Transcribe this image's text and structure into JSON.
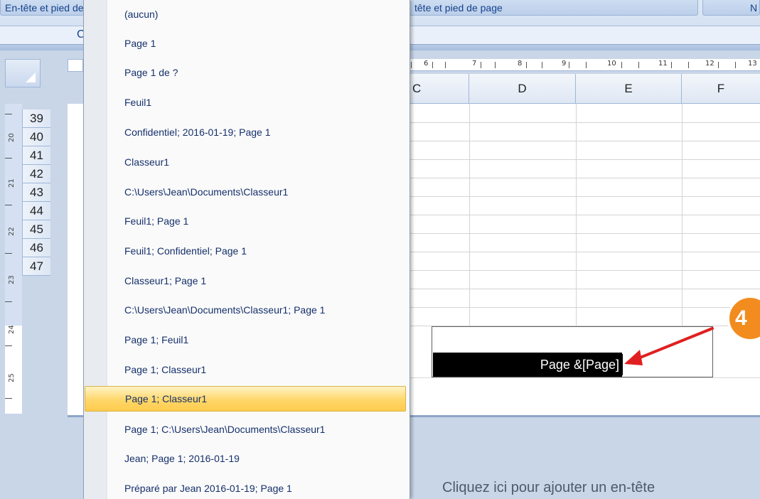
{
  "ribbon": {
    "group_left": "En-tête et pied de page",
    "group_center": "En-tête et pied de page",
    "group_center_visible": "tête et pied de page",
    "group_right": "N",
    "lower_letter": "C"
  },
  "ruler": {
    "numbers": [
      "6",
      "7",
      "8",
      "9",
      "10",
      "11",
      "12",
      "13"
    ]
  },
  "columns": [
    "C",
    "D",
    "E",
    "F"
  ],
  "rows": [
    "39",
    "40",
    "41",
    "42",
    "43",
    "44",
    "45",
    "46",
    "47"
  ],
  "vruler_numbers": [
    "20",
    "21",
    "22",
    "23",
    "24",
    "25"
  ],
  "footer_dropdown": {
    "items": [
      "(aucun)",
      "Page 1",
      "Page 1 de ?",
      "Feuil1",
      " Confidentiel; 2016-01-19; Page 1",
      "Classeur1",
      "C:\\Users\\Jean\\Documents\\Classeur1",
      "Feuil1; Page 1",
      "Feuil1;  Confidentiel; Page 1",
      "Classeur1; Page 1",
      "C:\\Users\\Jean\\Documents\\Classeur1; Page 1",
      "Page 1; Feuil1",
      "Page 1; Classeur1",
      "Page 1; Classeur1",
      "Page 1; C:\\Users\\Jean\\Documents\\Classeur1",
      "Jean; Page 1; 2016-01-19",
      "Préparé par Jean 2016-01-19; Page 1"
    ],
    "highlighted_index": 13
  },
  "footer_editor": {
    "code": "Page &[Page]"
  },
  "callout": {
    "number": "4",
    "color": "#f28c1f",
    "arrow_color": "#e02020"
  },
  "header_placeholder": "Cliquez ici pour ajouter un en-tête"
}
